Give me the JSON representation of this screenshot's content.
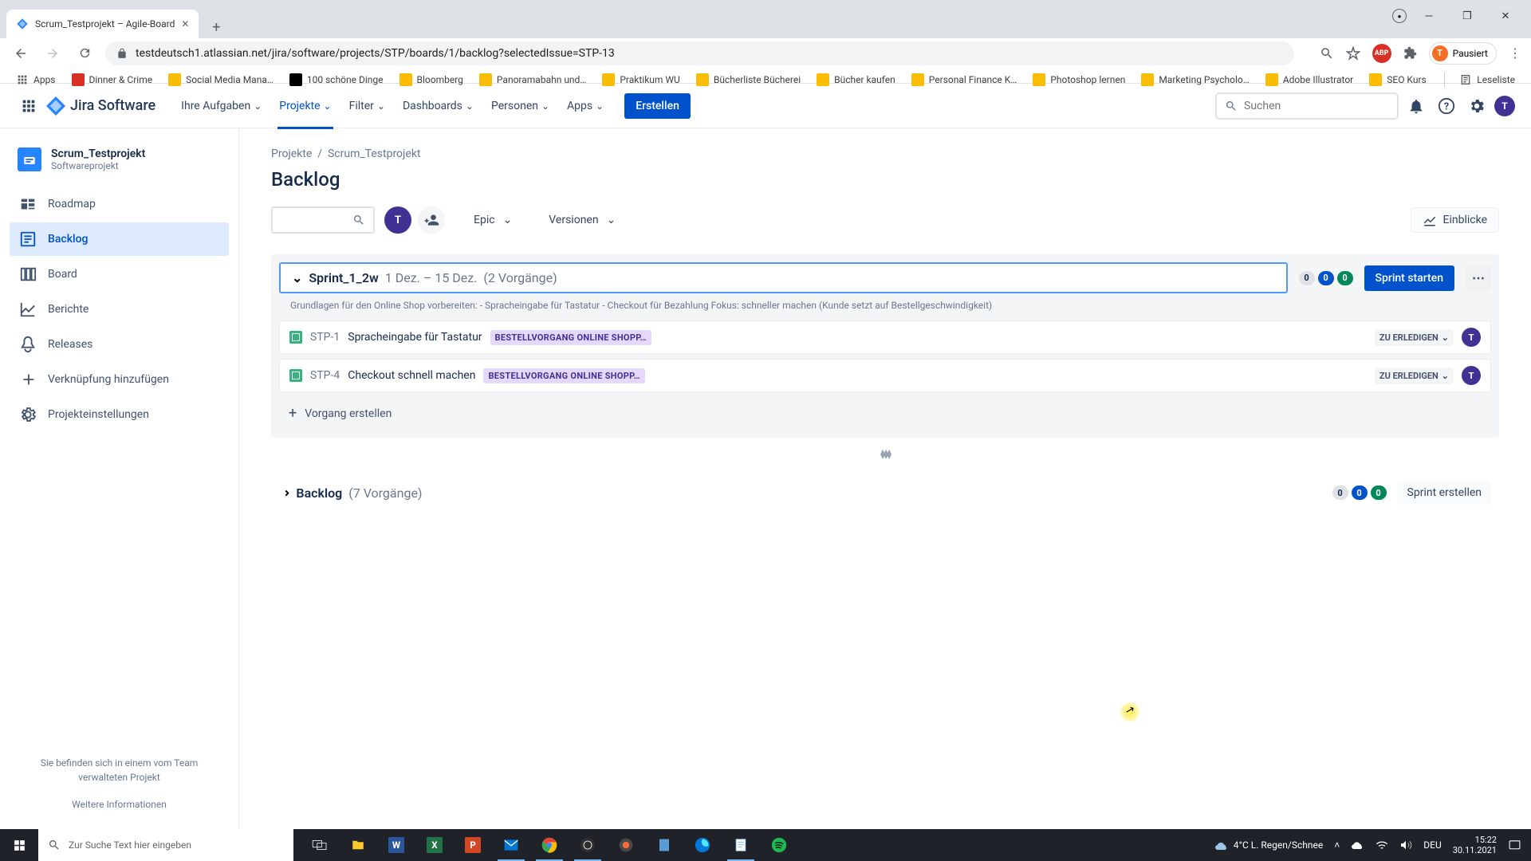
{
  "browser": {
    "tab_title": "Scrum_Testprojekt – Agile-Board",
    "url": "testdeutsch1.atlassian.net/jira/software/projects/STP/boards/1/backlog?selectedIssue=STP-13",
    "profile_label": "Pausiert",
    "profile_initial": "T",
    "bookmarks": [
      "Apps",
      "Dinner & Crime",
      "Social Media Mana…",
      "100 schöne Dinge",
      "Bloomberg",
      "Panoramabahn und…",
      "Praktikum WU",
      "Bücherliste Bücherei",
      "Bücher kaufen",
      "Personal Finance K…",
      "Photoshop lernen",
      "Marketing Psycholo…",
      "Adobe Illustrator",
      "SEO Kurs"
    ],
    "reading_list": "Leseliste",
    "abp": "ABP"
  },
  "nav": {
    "logo": "Jira Software",
    "items": [
      "Ihre Aufgaben",
      "Projekte",
      "Filter",
      "Dashboards",
      "Personen",
      "Apps"
    ],
    "active_index": 1,
    "create": "Erstellen",
    "search_placeholder": "Suchen",
    "avatar_initial": "T"
  },
  "sidebar": {
    "project_name": "Scrum_Testprojekt",
    "project_type": "Softwareprojekt",
    "items": [
      "Roadmap",
      "Backlog",
      "Board",
      "Berichte",
      "Releases",
      "Verknüpfung hinzufügen",
      "Projekteinstellungen"
    ],
    "active_index": 1,
    "footer_text": "Sie befinden sich in einem vom Team verwalteten Projekt",
    "footer_link": "Weitere Informationen"
  },
  "page": {
    "breadcrumb_projects": "Projekte",
    "breadcrumb_project": "Scrum_Testprojekt",
    "title": "Backlog",
    "avatar_initial": "T",
    "filter_epic": "Epic",
    "filter_versions": "Versionen",
    "insights": "Einblicke"
  },
  "sprint": {
    "name": "Sprint_1_2w",
    "dates": "1 Dez. – 15 Dez.",
    "count": "(2 Vorgänge)",
    "goal": "Grundlagen für den Online Shop vorbereiten: - Spracheingabe für Tastatur - Checkout für Bezahlung Fokus: schneller machen (Kunde setzt auf Bestellgeschwindigkeit)",
    "counts": {
      "gray": "0",
      "blue": "0",
      "green": "0"
    },
    "start_label": "Sprint starten",
    "issues": [
      {
        "key": "STP-1",
        "summary": "Spracheingabe für Tastatur",
        "epic": "BESTELLVORGANG ONLINE SHOPP…",
        "status": "ZU ERLEDIGEN",
        "assignee": "T"
      },
      {
        "key": "STP-4",
        "summary": "Checkout schnell machen",
        "epic": "BESTELLVORGANG ONLINE SHOPP…",
        "status": "ZU ERLEDIGEN",
        "assignee": "T"
      }
    ],
    "create_issue": "Vorgang erstellen"
  },
  "backlog": {
    "name": "Backlog",
    "count": "(7 Vorgänge)",
    "counts": {
      "gray": "0",
      "blue": "0",
      "green": "0"
    },
    "create_sprint": "Sprint erstellen"
  },
  "taskbar": {
    "search_placeholder": "Zur Suche Text hier eingeben",
    "weather": "4°C  L. Regen/Schnee",
    "lang": "DEU",
    "time": "15:22",
    "date": "30.11.2021"
  }
}
